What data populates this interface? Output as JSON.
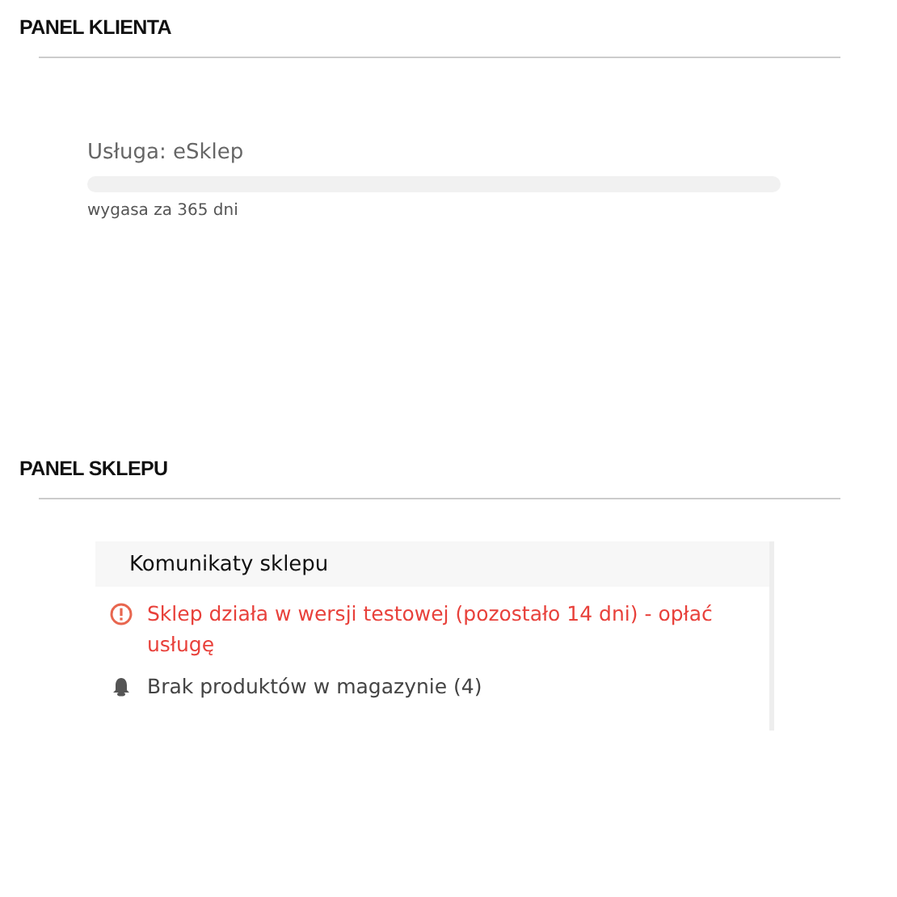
{
  "client_panel": {
    "title": "PANEL KLIENTA",
    "service": {
      "label": "Usługa: eSklep",
      "level": 0,
      "expiry": "wygasa za 365 dni"
    }
  },
  "shop_panel": {
    "title": "PANEL SKLEPU",
    "messages": {
      "title": "Komunikaty sklepu",
      "items": [
        {
          "kind": "alert",
          "text": "Sklep działa w wersji testowej (pozostało 14 dni) - opłać usługę"
        },
        {
          "kind": "bell",
          "text": "Brak produktów w magazynie (4)"
        }
      ]
    }
  }
}
